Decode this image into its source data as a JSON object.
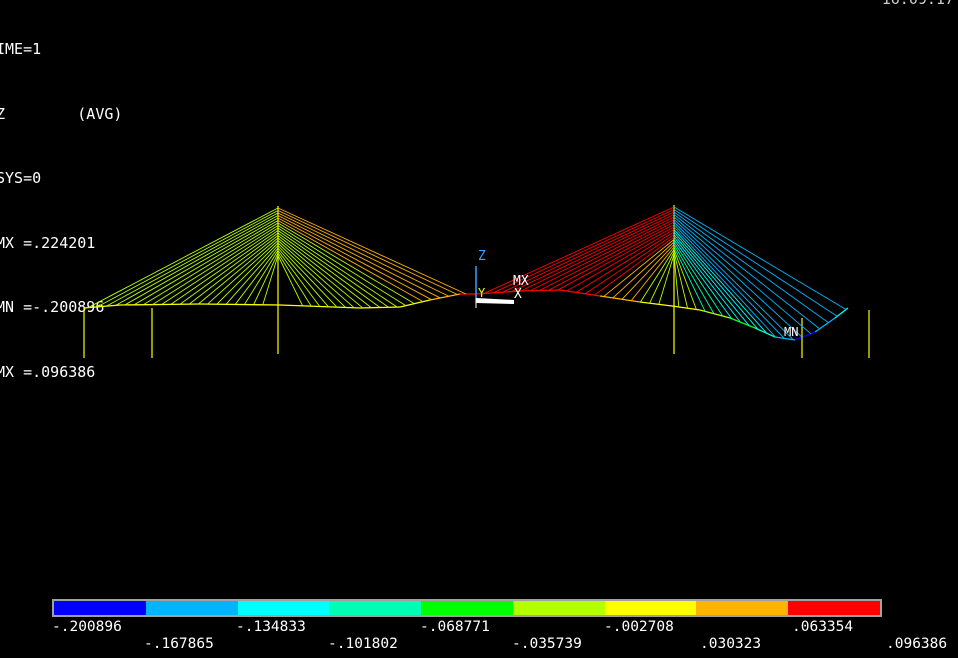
{
  "info": {
    "line1": "IME=1",
    "line2": "Z        (AVG)",
    "line3": "SYS=0",
    "line4": "MX =.224201",
    "line5": "MN =-.200896",
    "line6": "MX =.096386"
  },
  "clock": "16:09:17",
  "markers": {
    "max": "MX",
    "min": "MN"
  },
  "triad": {
    "z": "Z",
    "y": "Y",
    "x": "X"
  },
  "legend": {
    "colors": [
      "#0000ff",
      "#00b4ff",
      "#00ffff",
      "#00ffb4",
      "#00ff00",
      "#b4ff00",
      "#ffff00",
      "#ffb400",
      "#ff0000"
    ],
    "labels_top": [
      "-.200896",
      "-.134833",
      "-.068771",
      "-.002708",
      ".063354"
    ],
    "labels_bottom": [
      "-.167865",
      "-.101802",
      "-.035739",
      ".030323",
      ".096386"
    ]
  }
}
